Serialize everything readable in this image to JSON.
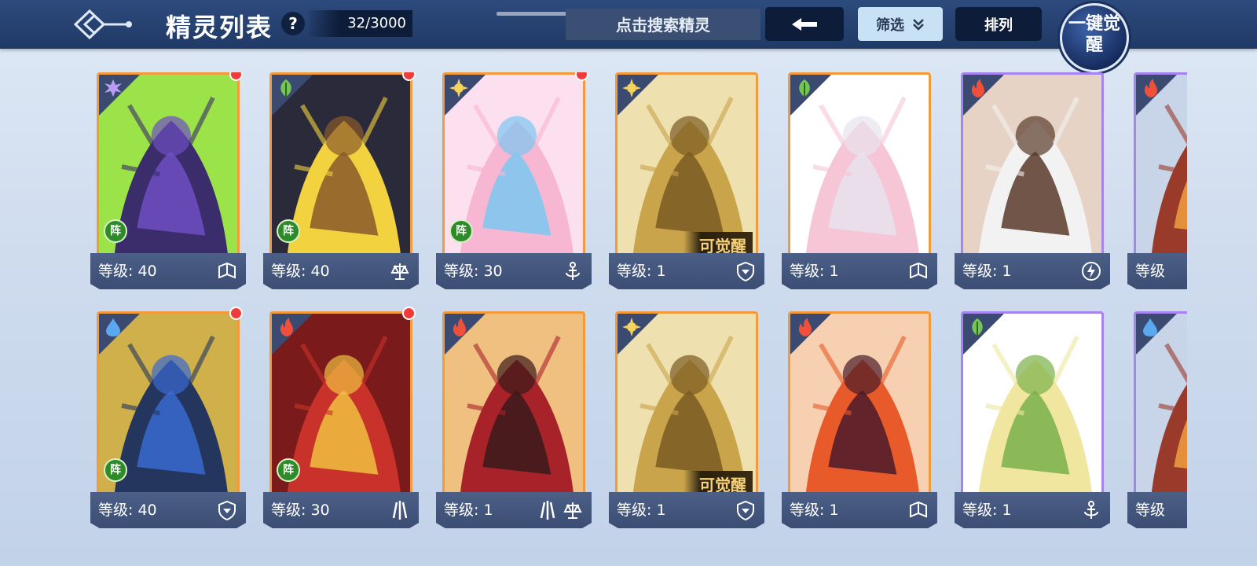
{
  "header": {
    "title": "精灵列表",
    "help_label": "?",
    "count": "32/3000",
    "search_placeholder": "点击搜索精灵",
    "filter_label": "筛选",
    "sort_label": "排列",
    "awaken_all_label": "一键觉醒"
  },
  "colors": {
    "topbar": "#203a66",
    "orange_frame": "#f39b3b",
    "purple_frame": "#a783f0",
    "formation_badge": "#2f8a2a",
    "red_dot": "#ef3b3b"
  },
  "cards": [
    {
      "level": "等级: 40",
      "element": "dark-icon",
      "frame": "orange",
      "formation": "阵",
      "awaken": "",
      "red_dot": true,
      "types": [
        "book-icon"
      ],
      "art": "dark-wolf-art"
    },
    {
      "level": "等级: 40",
      "element": "grass-icon",
      "frame": "orange",
      "formation": "阵",
      "awaken": "",
      "red_dot": true,
      "types": [
        "scales-icon"
      ],
      "art": "fox-adventurer-art"
    },
    {
      "level": "等级: 30",
      "element": "light-icon",
      "frame": "orange",
      "formation": "阵",
      "awaken": "",
      "red_dot": true,
      "types": [
        "anchor-icon"
      ],
      "art": "crystal-fox-art"
    },
    {
      "level": "等级: 1",
      "element": "light-icon",
      "frame": "orange",
      "formation": "",
      "awaken": "可觉醒",
      "red_dot": false,
      "types": [
        "shield-icon"
      ],
      "art": "golden-dragon-art"
    },
    {
      "level": "等级: 1",
      "element": "grass-icon",
      "frame": "orange",
      "formation": "",
      "awaken": "",
      "red_dot": false,
      "types": [
        "book-icon"
      ],
      "art": "fairy-girl-art"
    },
    {
      "level": "等级: 1",
      "element": "fire-icon",
      "frame": "purple",
      "formation": "",
      "awaken": "",
      "red_dot": false,
      "types": [
        "lightning-icon"
      ],
      "art": "twin-tail-girl-art"
    },
    {
      "level": "等级",
      "element": "fire-icon",
      "frame": "purple",
      "formation": "",
      "awaken": "",
      "red_dot": false,
      "types": [],
      "art": "partial-art"
    },
    {
      "level": "等级: 40",
      "element": "water-icon",
      "frame": "orange",
      "formation": "阵",
      "awaken": "",
      "red_dot": true,
      "types": [
        "shield-icon"
      ],
      "art": "blue-beast-art"
    },
    {
      "level": "等级: 30",
      "element": "fire-icon",
      "frame": "orange",
      "formation": "阵",
      "awaken": "",
      "red_dot": true,
      "types": [
        "claw-icon"
      ],
      "art": "red-wolf-art"
    },
    {
      "level": "等级: 1",
      "element": "fire-icon",
      "frame": "orange",
      "formation": "",
      "awaken": "",
      "red_dot": false,
      "types": [
        "claw-icon",
        "scales-icon"
      ],
      "art": "demon-lord-art"
    },
    {
      "level": "等级: 1",
      "element": "light-icon",
      "frame": "orange",
      "formation": "",
      "awaken": "可觉醒",
      "red_dot": false,
      "types": [
        "shield-icon"
      ],
      "art": "golden-dragon-art"
    },
    {
      "level": "等级: 1",
      "element": "fire-icon",
      "frame": "orange",
      "formation": "",
      "awaken": "",
      "red_dot": false,
      "types": [
        "book-icon"
      ],
      "art": "fire-girl-art"
    },
    {
      "level": "等级: 1",
      "element": "grass-icon",
      "frame": "purple",
      "formation": "",
      "awaken": "",
      "red_dot": false,
      "types": [
        "anchor-icon"
      ],
      "art": "forest-elf-art"
    },
    {
      "level": "等级",
      "element": "water-icon",
      "frame": "purple",
      "formation": "",
      "awaken": "",
      "red_dot": false,
      "types": [],
      "art": "partial-art"
    }
  ]
}
